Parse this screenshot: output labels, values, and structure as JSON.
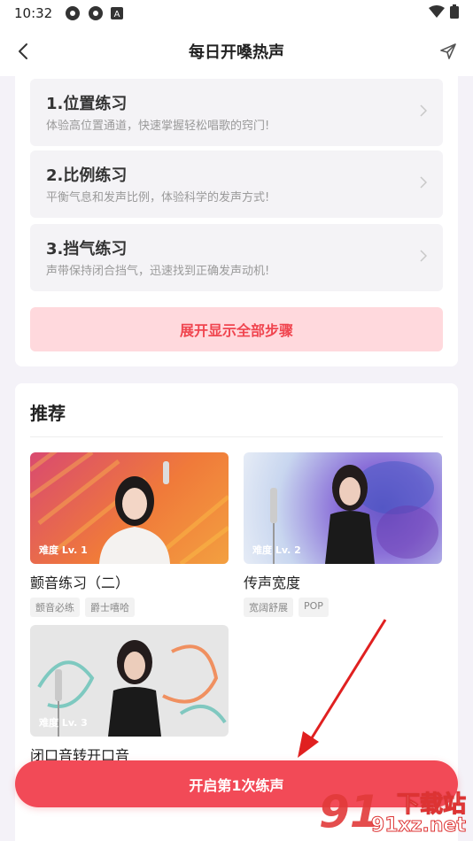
{
  "status_bar": {
    "time": "10:32"
  },
  "nav": {
    "title": "每日开嗓热声"
  },
  "steps": [
    {
      "title": "1.位置练习",
      "desc": "体验高位置通道，快速掌握轻松唱歌的窍门!"
    },
    {
      "title": "2.比例练习",
      "desc": "平衡气息和发声比例，体验科学的发声方式!"
    },
    {
      "title": "3.挡气练习",
      "desc": "声带保持闭合挡气，迅速找到正确发声动机!"
    }
  ],
  "expand_label": "展开显示全部步骤",
  "recommend": {
    "title": "推荐",
    "items": [
      {
        "level": "难度 Lv. 1",
        "title": "颤音练习（二）",
        "tags": [
          "颤音必练",
          "爵士嘻哈"
        ]
      },
      {
        "level": "难度 Lv. 2",
        "title": "传声宽度",
        "tags": [
          "宽阔舒展",
          "POP"
        ]
      },
      {
        "level": "难度 Lv. 3",
        "title": "闭口音转开口音",
        "tags": []
      }
    ]
  },
  "start_button": "开启第1次练声",
  "watermark": {
    "line1": "下载站",
    "line2": "91xz.net",
    "logo": "91"
  },
  "colors": {
    "accent": "#f24a57",
    "expand_bg": "#ffd9dd",
    "expand_text": "#f0454f",
    "arrow": "#e02020"
  }
}
